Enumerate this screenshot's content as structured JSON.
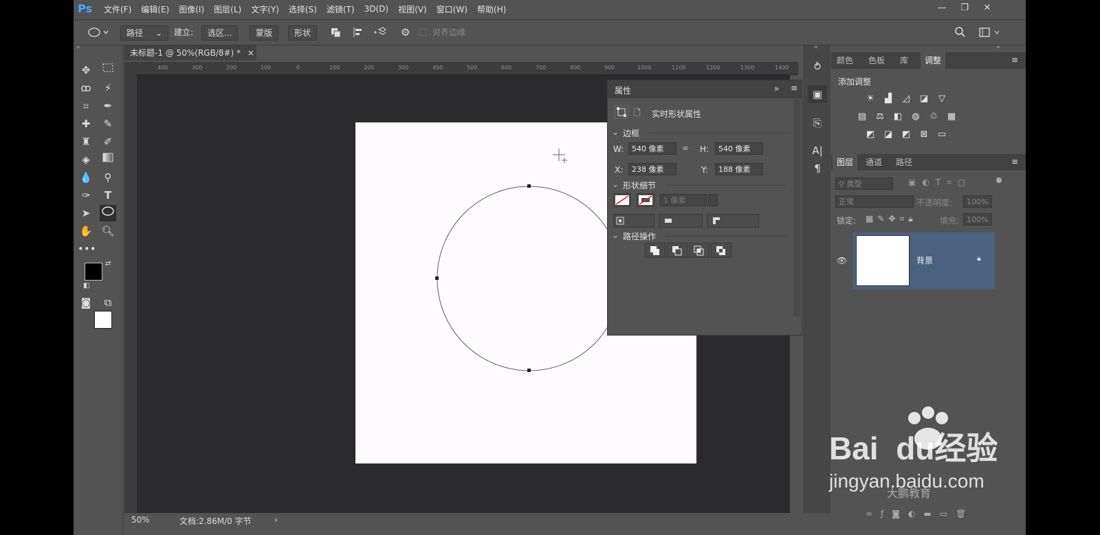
{
  "app": {
    "logo": "Ps"
  },
  "menu": [
    "文件(F)",
    "编辑(E)",
    "图像(I)",
    "图层(L)",
    "文字(Y)",
    "选择(S)",
    "滤镜(T)",
    "3D(D)",
    "视图(V)",
    "窗口(W)",
    "帮助(H)"
  ],
  "window_controls": {
    "minimize": "—",
    "restore": "❐",
    "close": "✕"
  },
  "options": {
    "tool_mode": "路径",
    "make_label": "建立:",
    "selection_btn": "选区...",
    "mask_btn": "蒙版",
    "shape_btn": "形状",
    "align_edges": "对齐边缘"
  },
  "document": {
    "tab_title": "未标题-1 @ 50%(RGB/8#) *",
    "close": "×",
    "ruler_ticks": [
      "400",
      "300",
      "200",
      "100",
      "0",
      "100",
      "200",
      "300",
      "400",
      "500",
      "600",
      "700",
      "800",
      "900",
      "1000",
      "1100",
      "1200",
      "1300",
      "1400"
    ],
    "zoom": "50%",
    "doc_info": "文档:2.86M/0 字节",
    "status_arrow": "›"
  },
  "properties": {
    "title": "属性",
    "mode_label": "实时形状属性",
    "bounds_section": "边框",
    "w_label": "W:",
    "w_value": "540 像素",
    "h_label": "H:",
    "h_value": "540 像素",
    "x_label": "X:",
    "x_value": "238 像素",
    "y_label": "Y:",
    "y_value": "188 像素",
    "shape_section": "形状细节",
    "stroke_width": "1 像素",
    "path_ops_section": "路径操作"
  },
  "right_panel": {
    "top_tabs": [
      "颜色",
      "色板",
      "库",
      "调整"
    ],
    "adjust_title": "添加调整",
    "layer_tabs": [
      "图层",
      "通道",
      "路径"
    ],
    "filter_label": "类型",
    "blend_mode": "正常",
    "opacity_label": "不透明度:",
    "opacity_value": "100%",
    "lock_label": "锁定:",
    "fill_label": "填充:",
    "fill_value": "100%",
    "layer_name": "背景"
  },
  "watermark": {
    "brand": "Bai",
    "brand2": "du",
    "tail": "经验",
    "url": "jingyan.baidu.com",
    "sub": "大鹏教育"
  },
  "colors": {
    "accent": "#4aa9ff",
    "selected_layer": "#4b6180",
    "panel": "#535353",
    "canvas_bg": "#2b2a2d"
  }
}
